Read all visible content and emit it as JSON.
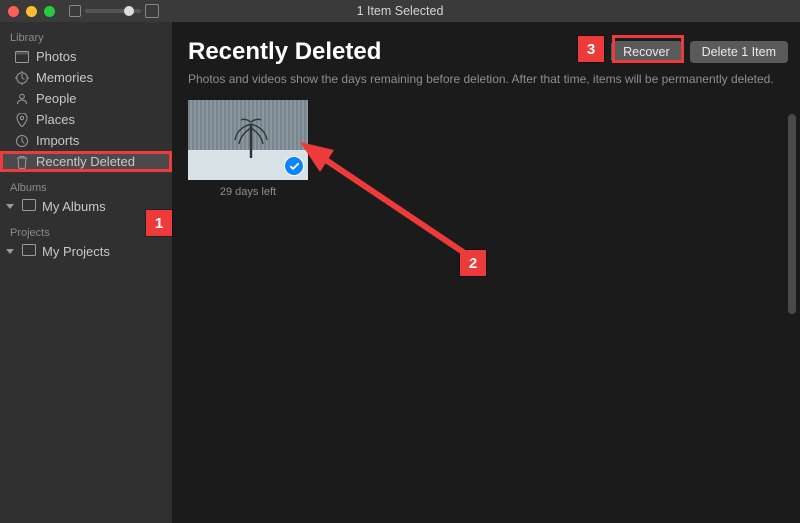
{
  "titlebar": {
    "title": "1 Item Selected"
  },
  "sidebar": {
    "library_label": "Library",
    "items": [
      {
        "label": "Photos"
      },
      {
        "label": "Memories"
      },
      {
        "label": "People"
      },
      {
        "label": "Places"
      },
      {
        "label": "Imports"
      },
      {
        "label": "Recently Deleted"
      }
    ],
    "albums_label": "Albums",
    "my_albums": "My Albums",
    "projects_label": "Projects",
    "my_projects": "My Projects"
  },
  "main": {
    "title": "Recently Deleted",
    "recover": "Recover",
    "delete": "Delete 1 Item",
    "description": "Photos and videos show the days remaining before deletion. After that time, items will be permanently deleted.",
    "thumb": {
      "days_left": "29 days left"
    }
  },
  "callouts": {
    "one": "1",
    "two": "2",
    "three": "3"
  }
}
